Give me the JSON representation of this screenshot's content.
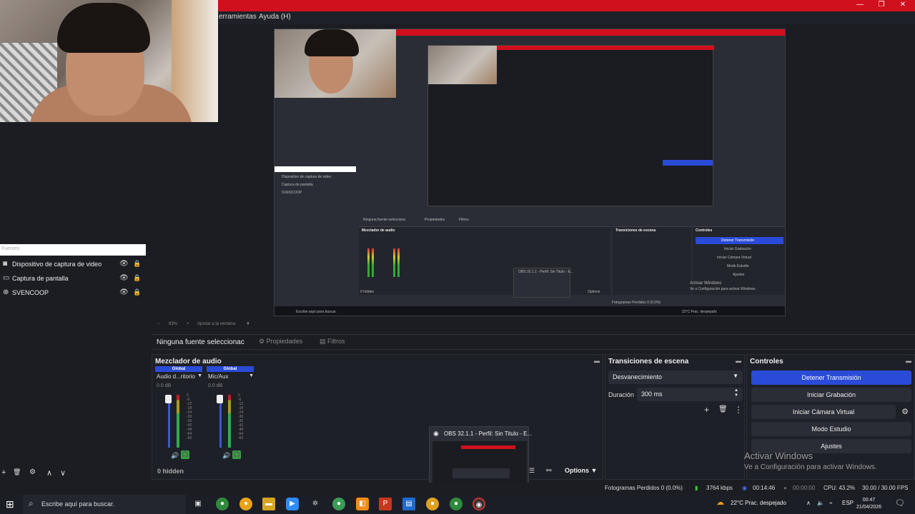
{
  "window": {
    "menu_items": [
      "erramientas",
      "Ayuda (H)"
    ],
    "controls": [
      "—",
      "❐",
      "✕"
    ]
  },
  "preview": {
    "zoom": "83%",
    "fit_label": "Ajustar a la ventana",
    "tiny_sources": [
      "Dispositivo de captura de video",
      "Captura de pantalla",
      "SVENCOOP"
    ],
    "tiny_mixer_title": "Mezclador de audio",
    "tiny_trans_title": "Transiciones de escena",
    "tiny_ctrl_title": "Controles",
    "tiny_ctrl_btns": [
      "Detener Transmisión",
      "Iniciar Grabación",
      "Iniciar Cámara Virtual",
      "Modo Estudio",
      "Ajustes"
    ],
    "tiny_status": "Fotogramas Perdidos 0 (0.0%)",
    "tiny_search": "Escribe aquí para buscar.",
    "tiny_activate": "Activar Windows",
    "tiny_activate2": "Ve a Configuración para activar Windows.",
    "tiny_nosource": "Ninguna fuente selecciona",
    "tiny_props": "Propiedades",
    "tiny_filters": "Filtros",
    "tiny_weather": "22°C Prac. despejado",
    "tiny_hidden": "0 hidden",
    "tiny_options": "Options",
    "tiny_thumb": "OBS 32.1.1 - Perfil: Sin Titulo - E..."
  },
  "sources": {
    "header": "Fuentes",
    "items": [
      {
        "label": "Dispositivo de captura de video",
        "icon": "camera-icon"
      },
      {
        "label": "Captura de pantalla",
        "icon": "monitor-icon"
      },
      {
        "label": "SVENCOOP",
        "icon": "gamepad-icon"
      }
    ],
    "toolbar": [
      "+",
      "🗑",
      "⚙",
      "∧",
      "∨"
    ]
  },
  "props_bar": {
    "no_source": "Ninguna fuente seleccionac",
    "properties": "Propiedades",
    "filters": "Filtros"
  },
  "mixer": {
    "title": "Mezclador de audio",
    "channels": [
      {
        "global": "Global",
        "name": "Audio d...ritorio",
        "db": "0.0 dB"
      },
      {
        "global": "Global",
        "name": "Mic/Aux",
        "db": "0.0 dB"
      }
    ],
    "scale": [
      "0",
      "-6",
      "-12",
      "-18",
      "-24",
      "-30",
      "-36",
      "-42",
      "-48",
      "-54",
      "-60"
    ],
    "hidden": "0 hidden",
    "options": "Options"
  },
  "transitions": {
    "title": "Transiciones de escena",
    "type": "Desvanecimiento",
    "duration_label": "Duración",
    "duration_value": "300 ms"
  },
  "controls": {
    "title": "Controles",
    "buttons": [
      "Detener Transmisión",
      "Iniciar Grabación",
      "Iniciar Cámara Virtual",
      "Modo Estudio",
      "Ajustes"
    ]
  },
  "activate": {
    "line1": "Activar Windows",
    "line2": "Ve a Configuración para activar Windows."
  },
  "thumbnail": {
    "title": "OBS 32.1.1 - Perfil: Sin Titulo - E..."
  },
  "status": {
    "dropped": "Fotogramas Perdidos 0 (0.0%)",
    "bitrate": "3764 kbps",
    "stream_time": "00:14:46",
    "rec_time": "00:00:00",
    "cpu": "CPU: 43.2%",
    "fps": "30.00 / 30.00 FPS"
  },
  "taskbar": {
    "search_placeholder": "Escribe aquí para buscar.",
    "weather": "22°C  Prac. despejado",
    "lang": "ESP",
    "time": "00:47",
    "date": "21/04/2026"
  }
}
